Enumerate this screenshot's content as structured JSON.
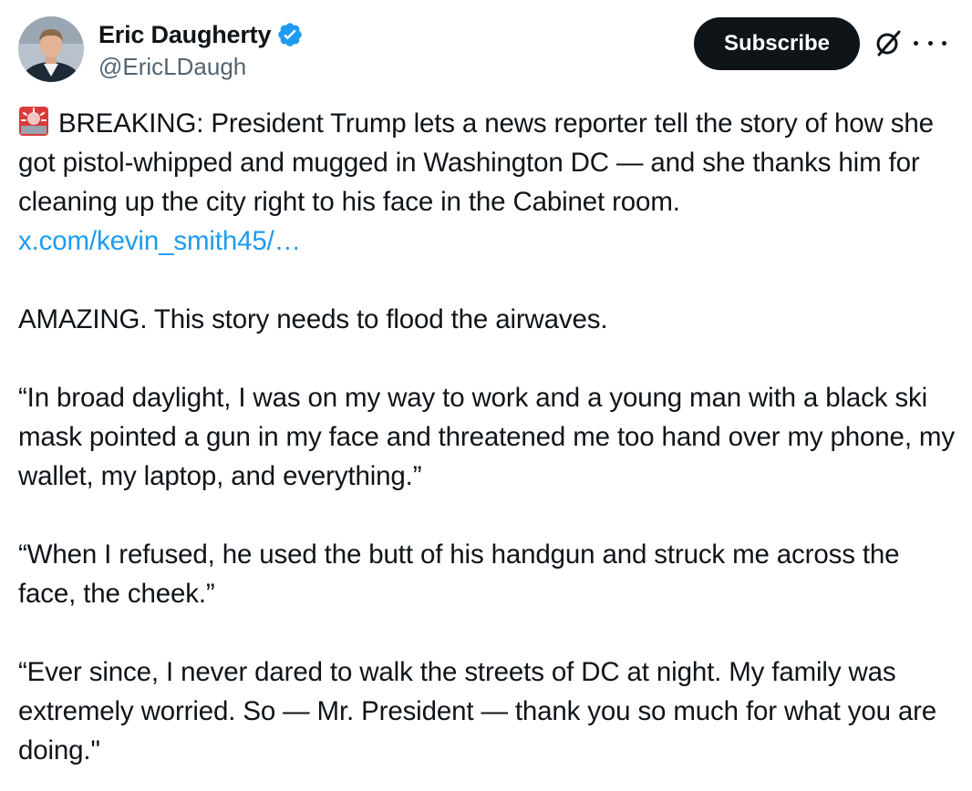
{
  "author": {
    "display_name": "Eric Daugherty",
    "handle": "@EricLDaugh",
    "verified": true,
    "verified_color": "#1d9bf0",
    "avatar_icon": "profile-photo"
  },
  "actions": {
    "subscribe_label": "Subscribe",
    "grok_icon": "grok-icon",
    "more_icon": "more-icon"
  },
  "tweet": {
    "siren_icon": "police-light-emoji",
    "line1": "BREAKING: President Trump lets a news reporter tell the story of how she got pistol-whipped and mugged in Washington DC — and she thanks him for cleaning up the city right to his face in the Cabinet room.",
    "link": "x.com/kevin_smith45/…",
    "link_color": "#1d9bf0",
    "para2": "AMAZING. This story needs to flood the airwaves.",
    "para3": "“In broad daylight, I was on my way to work and a young man with a black ski mask pointed a gun in my face and threatened me too hand over my phone, my wallet, my laptop, and everything.”",
    "para4": "“When I refused, he used the butt of his handgun and struck me across the face, the cheek.”",
    "para5": "“Ever since, I never dared to walk the streets of DC at night. My family was extremely worried. So — Mr. President — thank you so much for what you are doing.\""
  }
}
